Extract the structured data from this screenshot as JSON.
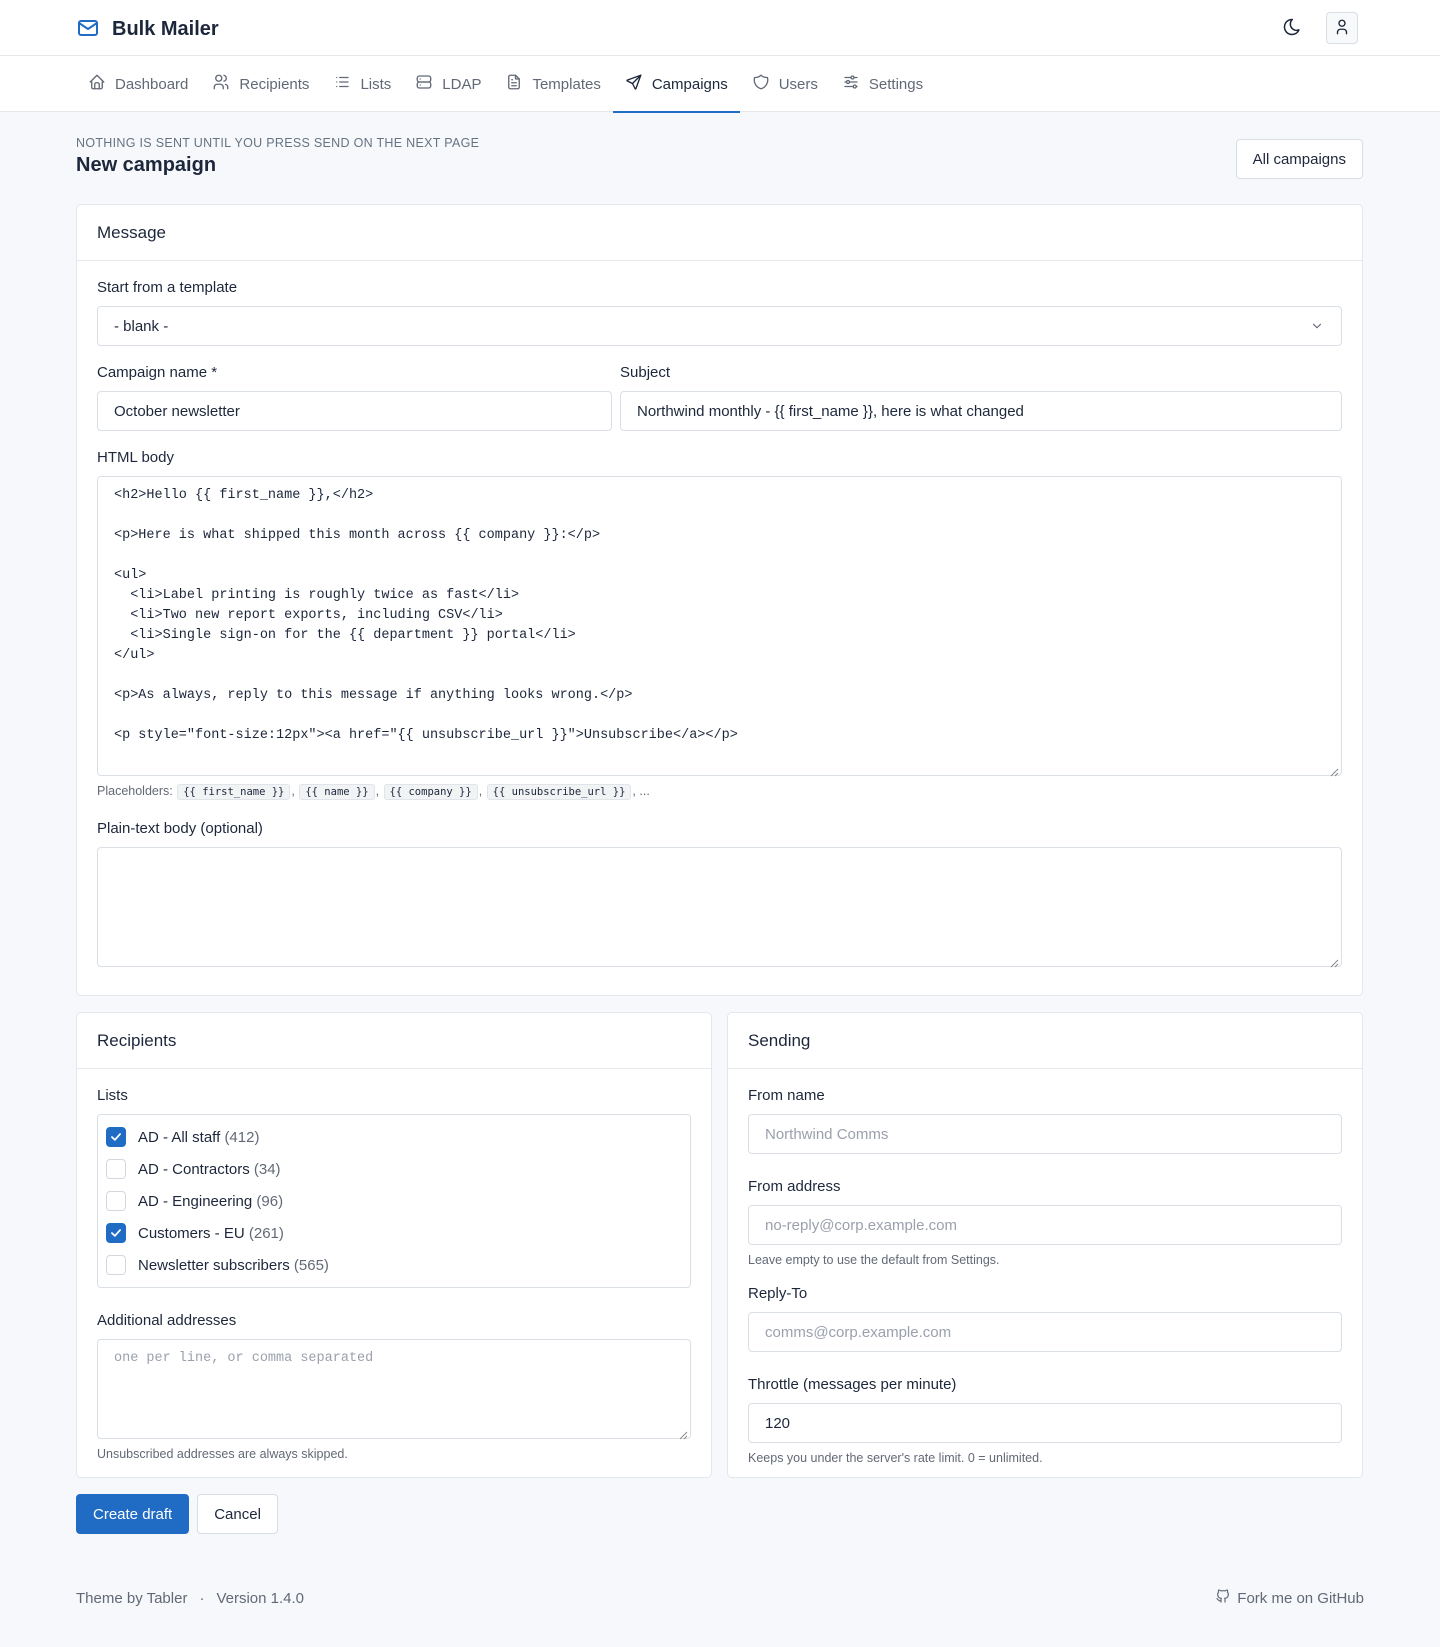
{
  "app": {
    "name": "Bulk Mailer"
  },
  "nav": {
    "items": [
      {
        "label": "Dashboard",
        "icon": "home-icon"
      },
      {
        "label": "Recipients",
        "icon": "users-icon"
      },
      {
        "label": "Lists",
        "icon": "list-icon"
      },
      {
        "label": "LDAP",
        "icon": "server-icon"
      },
      {
        "label": "Templates",
        "icon": "file-icon"
      },
      {
        "label": "Campaigns",
        "icon": "send-icon"
      },
      {
        "label": "Users",
        "icon": "shield-icon"
      },
      {
        "label": "Settings",
        "icon": "sliders-icon"
      }
    ],
    "active": "Campaigns"
  },
  "header": {
    "pretitle": "NOTHING IS SENT UNTIL YOU PRESS SEND ON THE NEXT PAGE",
    "title": "New campaign",
    "all_campaigns_label": "All campaigns"
  },
  "message": {
    "card_title": "Message",
    "template_label": "Start from a template",
    "template_value": "- blank -",
    "name_label": "Campaign name *",
    "name_value": "October newsletter",
    "subject_label": "Subject",
    "subject_value": "Northwind monthly - {{ first_name }}, here is what changed",
    "html_body_label": "HTML body",
    "html_body_value": "<h2>Hello {{ first_name }},</h2>\n\n<p>Here is what shipped this month across {{ company }}:</p>\n\n<ul>\n  <li>Label printing is roughly twice as fast</li>\n  <li>Two new report exports, including CSV</li>\n  <li>Single sign-on for the {{ department }} portal</li>\n</ul>\n\n<p>As always, reply to this message if anything looks wrong.</p>\n\n<p style=\"font-size:12px\"><a href=\"{{ unsubscribe_url }}\">Unsubscribe</a></p>",
    "placeholders_label": "Placeholders:",
    "placeholders": [
      "{{ first_name }}",
      "{{ name }}",
      "{{ company }}",
      "{{ unsubscribe_url }}"
    ],
    "placeholders_more": "...",
    "plain_body_label": "Plain-text body (optional)",
    "plain_body_value": ""
  },
  "recipients": {
    "card_title": "Recipients",
    "lists_label": "Lists",
    "lists": [
      {
        "name": "AD - All staff",
        "count": "(412)",
        "checked": true
      },
      {
        "name": "AD - Contractors",
        "count": "(34)",
        "checked": false
      },
      {
        "name": "AD - Engineering",
        "count": "(96)",
        "checked": false
      },
      {
        "name": "Customers - EU",
        "count": "(261)",
        "checked": true
      },
      {
        "name": "Newsletter subscribers",
        "count": "(565)",
        "checked": false
      }
    ],
    "additional_label": "Additional addresses",
    "additional_placeholder": "one per line, or comma separated",
    "unsubscribed_hint": "Unsubscribed addresses are always skipped."
  },
  "sending": {
    "card_title": "Sending",
    "from_name_label": "From name",
    "from_name_placeholder": "Northwind Comms",
    "from_address_label": "From address",
    "from_address_placeholder": "no-reply@corp.example.com",
    "from_address_hint": "Leave empty to use the default from Settings.",
    "reply_to_label": "Reply-To",
    "reply_to_placeholder": "comms@corp.example.com",
    "throttle_label": "Throttle (messages per minute)",
    "throttle_value": "120",
    "throttle_hint": "Keeps you under the server's rate limit. 0 = unlimited."
  },
  "actions": {
    "create_label": "Create draft",
    "cancel_label": "Cancel"
  },
  "footer": {
    "theme": "Theme by Tabler",
    "separator": "·",
    "version": "Version 1.4.0",
    "github": "Fork me on GitHub"
  },
  "colors": {
    "primary": "#206bc4",
    "background": "#f6f8fb",
    "text": "#1d273b",
    "muted": "#626976"
  }
}
